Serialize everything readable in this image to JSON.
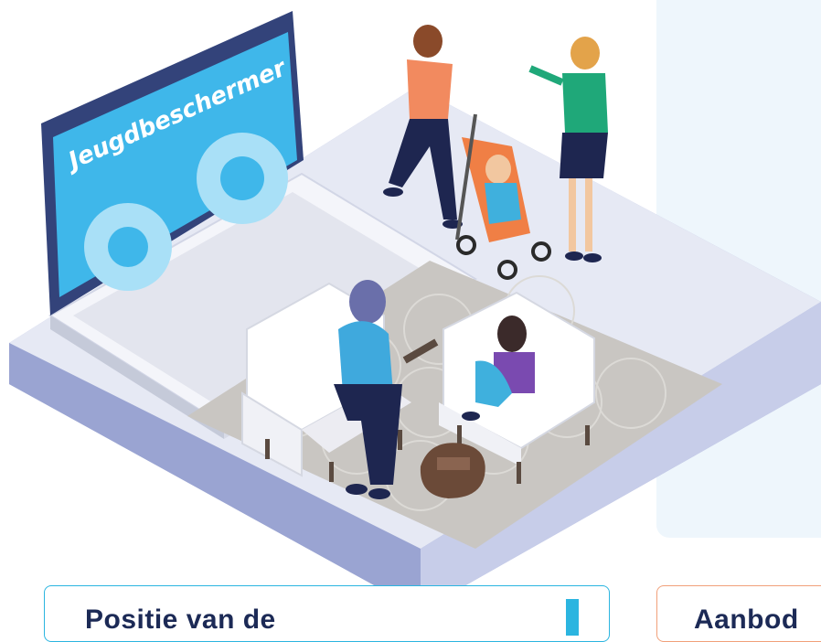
{
  "illustration": {
    "screen_label": "Jeugdbeschermer"
  },
  "cards": {
    "left_title": "Positie van de",
    "right_title": "Aanbod"
  },
  "colors": {
    "panel_bg": "#eef6fc",
    "left_card_border": "#2bb5e0",
    "right_card_border": "#f1a07a",
    "title_text": "#1c2a56"
  }
}
